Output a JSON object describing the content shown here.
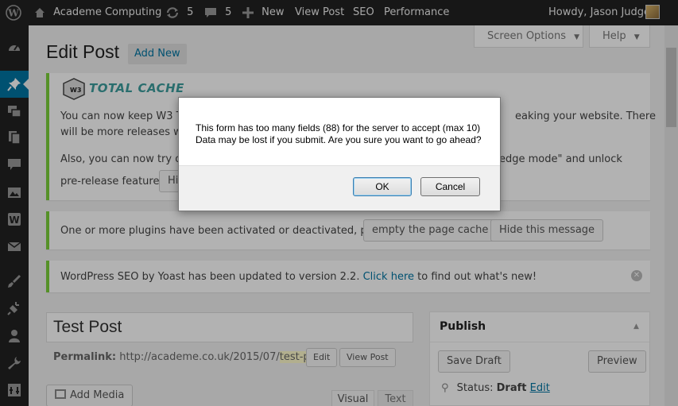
{
  "admin_bar": {
    "site_name": "Academe Computing",
    "updates_count": "5",
    "comments_count": "5",
    "new_label": "New",
    "view_post_label": "View Post",
    "seo_label": "SEO",
    "performance_label": "Performance",
    "greeting": "Howdy, Jason Judge"
  },
  "screen_options": "Screen Options",
  "help": "Help",
  "page": {
    "title": "Edit Post",
    "add_new": "Add New"
  },
  "w3tc": {
    "logo_text": "TOTAL CACHE",
    "line1": "You can now keep W3 To",
    "line1_end": "eaking your website. There",
    "line2": "will be more releases wit",
    "line3": "Also, you can now try out",
    "line3_end": "edge mode\" and unlock",
    "line4": "pre-release features.",
    "hide_btn": "Hi"
  },
  "plugins_notice": {
    "text": "One or more plugins have been activated or deactivated, please",
    "empty_cache_btn": "empty the page cache",
    "hide_btn": "Hide this message"
  },
  "yoast_notice": {
    "text": "WordPress SEO by Yoast has been updated to version 2.2.",
    "link": "Click here",
    "text_end": "to find out what's new!"
  },
  "post": {
    "title": "Test Post",
    "permalink_label": "Permalink:",
    "permalink_base": "http://academe.co.uk/2015/07/",
    "permalink_slug": "test-post",
    "permalink_tail": "/",
    "edit_btn": "Edit",
    "view_post_btn": "View Post",
    "add_media": "Add Media",
    "tab_visual": "Visual",
    "tab_text": "Text"
  },
  "publish": {
    "title": "Publish",
    "save_draft": "Save Draft",
    "preview": "Preview",
    "status_label": "Status:",
    "status_value": "Draft",
    "status_edit": "Edit"
  },
  "dialog": {
    "line1": "This form has too many fields (88) for the server to accept (max 10)",
    "line2": "Data may be lost if you submit. Are you sure you want to go ahead?",
    "ok": "OK",
    "cancel": "Cancel"
  },
  "colors": {
    "admin_bar": "#222222",
    "accent": "#0074a2",
    "notice_green": "#7ad03a",
    "link": "#0074a2"
  }
}
